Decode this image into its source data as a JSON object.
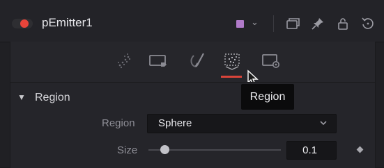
{
  "header": {
    "title": "pEmitter1",
    "color_swatch": "#b07ac9",
    "toggle_color": "#e8443a",
    "icons": [
      "version-icon",
      "pin-icon",
      "lock-icon",
      "reset-icon"
    ]
  },
  "tabs": {
    "items": [
      {
        "icon": "particles-icon"
      },
      {
        "icon": "tag-icon"
      },
      {
        "icon": "brush-icon"
      },
      {
        "icon": "region-icon",
        "active": true
      },
      {
        "icon": "settings-icon"
      }
    ],
    "accent_color": "#d9443a"
  },
  "tooltip": {
    "text": "Region"
  },
  "section": {
    "title": "Region",
    "expanded": true
  },
  "controls": {
    "region_label": "Region",
    "region_value": "Sphere",
    "size_label": "Size",
    "size_value": "0.1",
    "size_slider_fraction": 0.1
  }
}
